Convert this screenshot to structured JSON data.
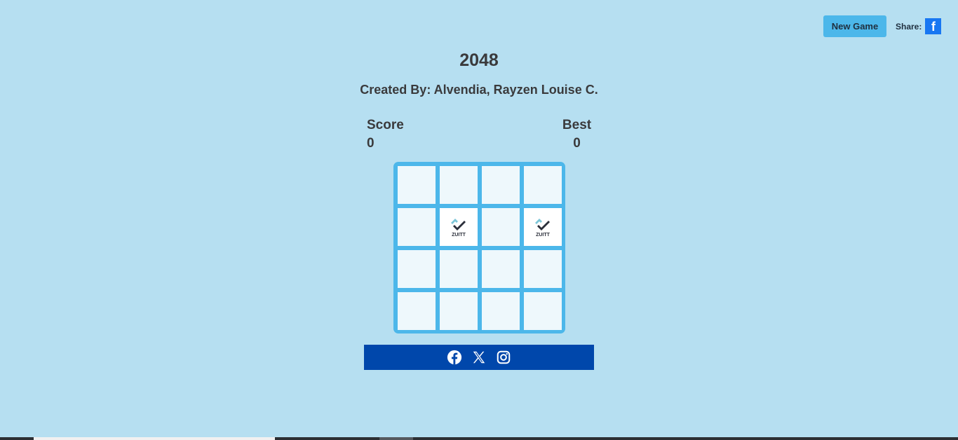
{
  "header": {
    "new_game_label": "New Game",
    "share_label": "Share:",
    "share_icon": "facebook-icon",
    "share_icon_glyph": "f"
  },
  "game": {
    "title": "2048",
    "credit": "Created By: Alvendia, Rayzen Louise C.",
    "score_label": "Score",
    "score_value": "0",
    "best_label": "Best",
    "best_value": "0"
  },
  "board": {
    "size": 4,
    "tiles": [
      {
        "row": 2,
        "col": 2,
        "icon": "zuitt-logo-icon",
        "text": "ZUITT"
      },
      {
        "row": 2,
        "col": 4,
        "icon": "zuitt-logo-icon",
        "text": "ZUITT"
      }
    ]
  },
  "footer": {
    "social_icons": [
      "facebook-icon",
      "x-icon",
      "instagram-icon"
    ]
  },
  "colors": {
    "background": "#b6dff1",
    "board": "#4cb7ea",
    "empty_cell": "#eef8fc",
    "tile": "#ffffff",
    "button": "#4cb7ea",
    "footer": "#0047ab",
    "facebook": "#1877f2",
    "text": "#3a3a3c"
  }
}
